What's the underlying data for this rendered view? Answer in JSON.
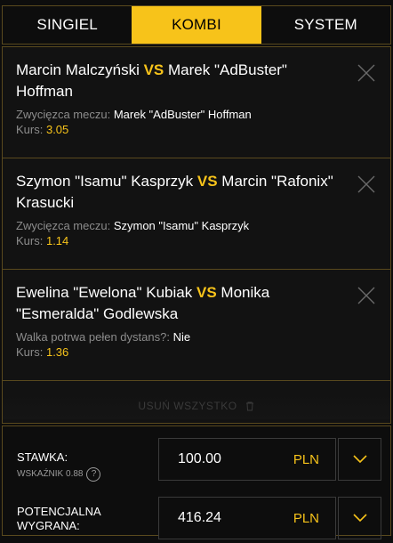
{
  "tabs": [
    {
      "label": "SINGIEL",
      "active": false
    },
    {
      "label": "KOMBI",
      "active": true
    },
    {
      "label": "SYSTEM",
      "active": false
    }
  ],
  "bets": [
    {
      "player1": "Marcin Malczyński",
      "vs": "VS",
      "player2": "Marek \"AdBuster\" Hoffman",
      "market": "Zwycięzca meczu:",
      "selection": "Marek \"AdBuster\" Hoffman",
      "odds_label": "Kurs:",
      "odds": "3.05"
    },
    {
      "player1": "Szymon \"Isamu\" Kasprzyk",
      "vs": "VS",
      "player2": "Marcin \"Rafonix\" Krasucki",
      "market": "Zwycięzca meczu:",
      "selection": "Szymon \"Isamu\" Kasprzyk",
      "odds_label": "Kurs:",
      "odds": "1.14"
    },
    {
      "player1": "Ewelina \"Ewelona\" Kubiak",
      "vs": "VS",
      "player2": "Monika \"Esmeralda\" Godlewska",
      "market": "Walka potrwa pełen dystans?:",
      "selection": "Nie",
      "odds_label": "Kurs:",
      "odds": "1.36"
    }
  ],
  "clear_all": {
    "label": "USUŃ WSZYSTKO",
    "icon": "trash-icon"
  },
  "stake": {
    "label": "STAWKA:",
    "indicator": "WSKAŹNIK 0.88",
    "help": "?",
    "value": "100.00",
    "currency": "PLN"
  },
  "potential_win": {
    "label": "POTENCJALNA WYGRANA:",
    "value": "416.24",
    "currency": "PLN"
  },
  "colors": {
    "accent": "#f7c31a",
    "border": "#5a4a1e",
    "background": "#0d0d0d"
  }
}
